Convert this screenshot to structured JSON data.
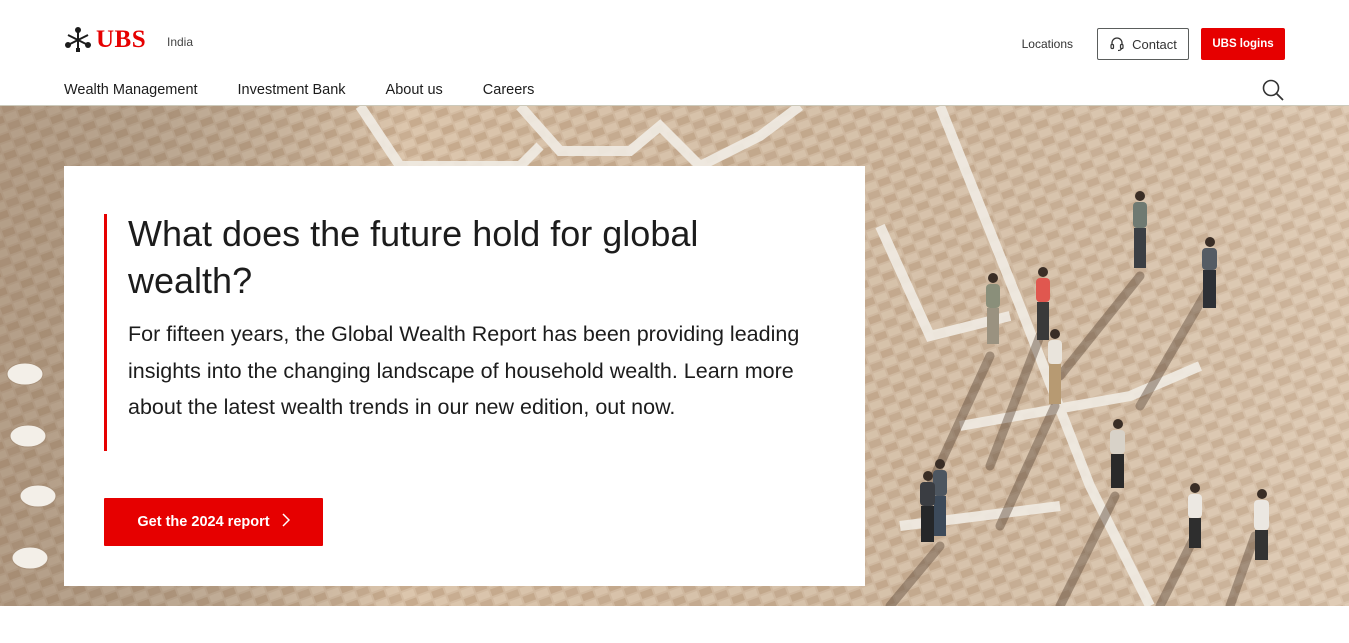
{
  "header": {
    "logo_text": "UBS",
    "region": "India",
    "locations_label": "Locations",
    "contact_label": "Contact",
    "logins_label": "UBS logins",
    "nav": [
      {
        "label": "Wealth Management"
      },
      {
        "label": "Investment Bank"
      },
      {
        "label": "About us"
      },
      {
        "label": "Careers"
      }
    ],
    "search_icon": "search-icon"
  },
  "hero": {
    "headline": "What does the future hold for global wealth?",
    "lead": "For fifteen years, the Global Wealth Report has been providing leading insights into the changing landscape of household wealth. Learn more about the latest wealth trends in our new edition, out now.",
    "cta_label": "Get the 2024 report"
  },
  "colors": {
    "brand_red": "#e60000",
    "text": "#1c1c1c",
    "border": "#5a5d5c"
  }
}
